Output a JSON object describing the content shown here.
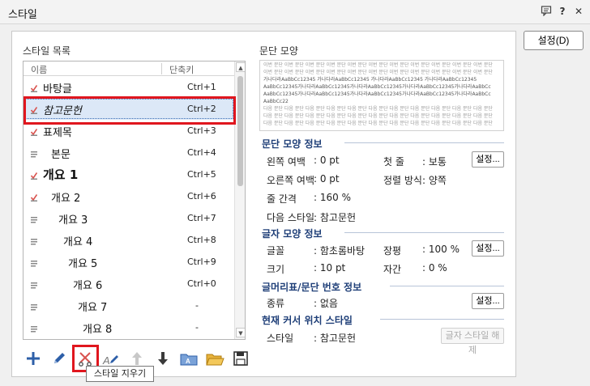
{
  "window": {
    "title": "스타일",
    "help_label": "?",
    "close_label": "✕"
  },
  "actions": {
    "ok_label": "설정(D)"
  },
  "style_list": {
    "label": "스타일 목록",
    "col_name": "이름",
    "col_shortcut": "단축키",
    "items": [
      {
        "name": "바탕글",
        "shortcut": "Ctrl+1",
        "icon": "paragraph-check"
      },
      {
        "name": "참고문헌",
        "shortcut": "Ctrl+2",
        "icon": "paragraph-check"
      },
      {
        "name": "표제목",
        "shortcut": "Ctrl+3",
        "icon": "paragraph-check"
      },
      {
        "name": "본문",
        "shortcut": "Ctrl+4",
        "icon": "paragraph"
      },
      {
        "name": "개요 1",
        "shortcut": "Ctrl+5",
        "icon": "paragraph-check"
      },
      {
        "name": "개요 2",
        "shortcut": "Ctrl+6",
        "icon": "paragraph-check"
      },
      {
        "name": "개요 3",
        "shortcut": "Ctrl+7",
        "icon": "paragraph"
      },
      {
        "name": "개요 4",
        "shortcut": "Ctrl+8",
        "icon": "paragraph"
      },
      {
        "name": "개요 5",
        "shortcut": "Ctrl+9",
        "icon": "paragraph"
      },
      {
        "name": "개요 6",
        "shortcut": "Ctrl+0",
        "icon": "paragraph"
      },
      {
        "name": "개요 7",
        "shortcut": "-",
        "icon": "paragraph"
      },
      {
        "name": "개요 8",
        "shortcut": "-",
        "icon": "paragraph"
      }
    ]
  },
  "toolbar": {
    "tooltip": "스타일 지우기"
  },
  "preview": {
    "label": "문단 모양",
    "before": "이번 문단 이번 문단 이번 문단 이번 문단 이번 문단 이번 문단 이번 문단 이번 문단 이번 문단 이번 문단 이번 문단",
    "sample1": "가나다라AaBbCc12345  가나다라AaBbCc12345  가나다라AaBbCc12345  가나다라AaBbCc12345",
    "sample2": "AaBbCc12345가나다라AaBbCc12345가나다라AaBbCc12345가나다라AaBbCc12345가나다라AaBbCc",
    "sample3": "AaBbCc12345가나다라AaBbCc12345가나다라AaBbCc12345가나다라AaBbCc12345가나다라AaBbCc",
    "sample4": "AaBbCc22",
    "after": "다음 문단 다음 문단 다음 문단 다음 문단 다음 문단 다음 문단 다음 문단 다음 문단 다음 문단 다음 문단 다음 문단"
  },
  "para_info": {
    "title": "문단 모양 정보",
    "left_margin_label": "왼쪽 여백",
    "left_margin": ": 0 pt",
    "indent_label": "첫 줄",
    "indent": ": 보통",
    "right_margin_label": "오른쪽 여백",
    "right_margin": ": 0 pt",
    "align_label": "정렬 방식",
    "align": ": 양쪽",
    "line_spacing_label": "줄 간격",
    "line_spacing": ": 160 %",
    "next_style_label": "다음 스타일",
    "next_style": ": 참고문헌",
    "set_label": "설정..."
  },
  "char_info": {
    "title": "글자 모양 정보",
    "font_label": "글꼴",
    "font": ": 함초롬바탕",
    "ratio_label": "장평",
    "ratio": ": 100 %",
    "size_label": "크기",
    "size": ": 10 pt",
    "spacing_label": "자간",
    "spacing": ": 0 %",
    "set_label": "설정..."
  },
  "numbering_info": {
    "title": "글머리표/문단 번호 정보",
    "type_label": "종류",
    "type": ": 없음",
    "set_label": "설정..."
  },
  "cursor_info": {
    "title": "현재 커서 위치 스타일",
    "style_label": "스타일",
    "style": ": 참고문헌",
    "release_label": "글자 스타일 해제"
  },
  "colors": {
    "accent": "#1f3f78",
    "highlight": "#e0161e",
    "selection": "#dce8f7"
  }
}
